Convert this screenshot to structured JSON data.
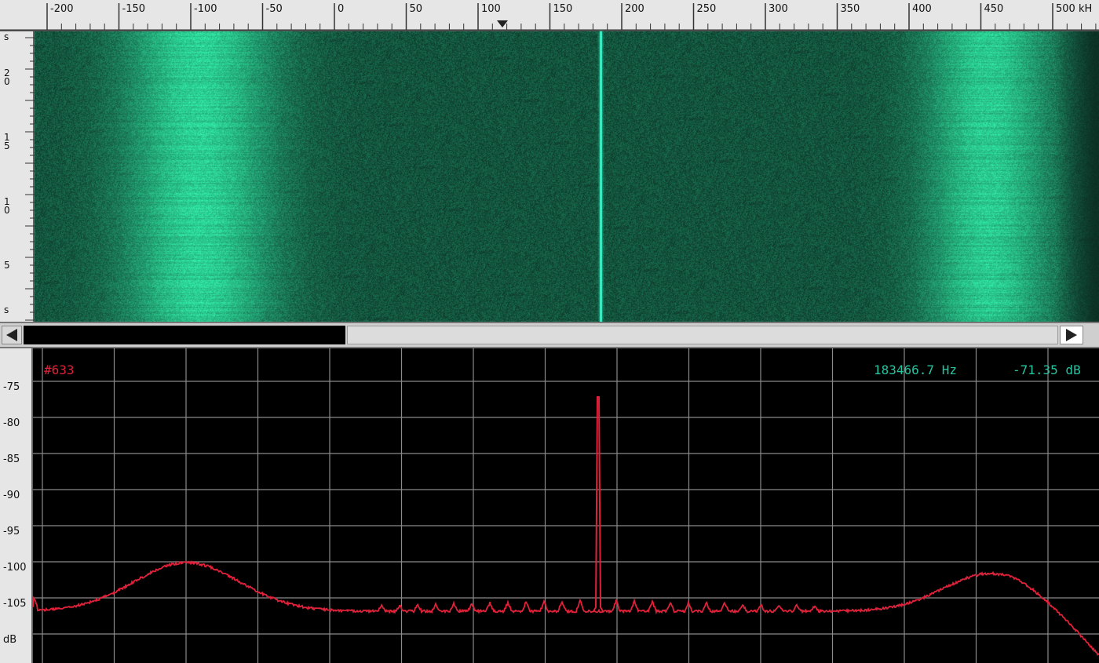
{
  "freq_ruler": {
    "ticks": [
      "-200",
      "-150",
      "-100",
      "-50",
      "0",
      "50",
      "100",
      "150",
      "200",
      "250",
      "300",
      "350",
      "400",
      "450",
      "500 kH"
    ]
  },
  "time_ruler": {
    "labels": [
      "s",
      "2\n0",
      "1\n5",
      "1\n0",
      "5",
      "s"
    ]
  },
  "spectrum": {
    "trace_label": "#633",
    "frequency_readout": "183466.7 Hz",
    "level_readout": "-71.35 dB",
    "db_ticks": [
      "-75",
      "-80",
      "-85",
      "-90",
      "-95",
      "-100",
      "-105",
      "dB"
    ]
  },
  "colors": {
    "waterfall_base": "#0d3a2c",
    "waterfall_hump": "#2fe0a8",
    "carrier": "#3be9c0",
    "trace": "#e0213a",
    "readout": "#24c5a0",
    "grid": "#8a8a8a"
  },
  "icons": {
    "scroll_left": "left-arrow-icon",
    "scroll_right": "right-arrow-icon",
    "marker": "triangle-down-icon"
  }
}
